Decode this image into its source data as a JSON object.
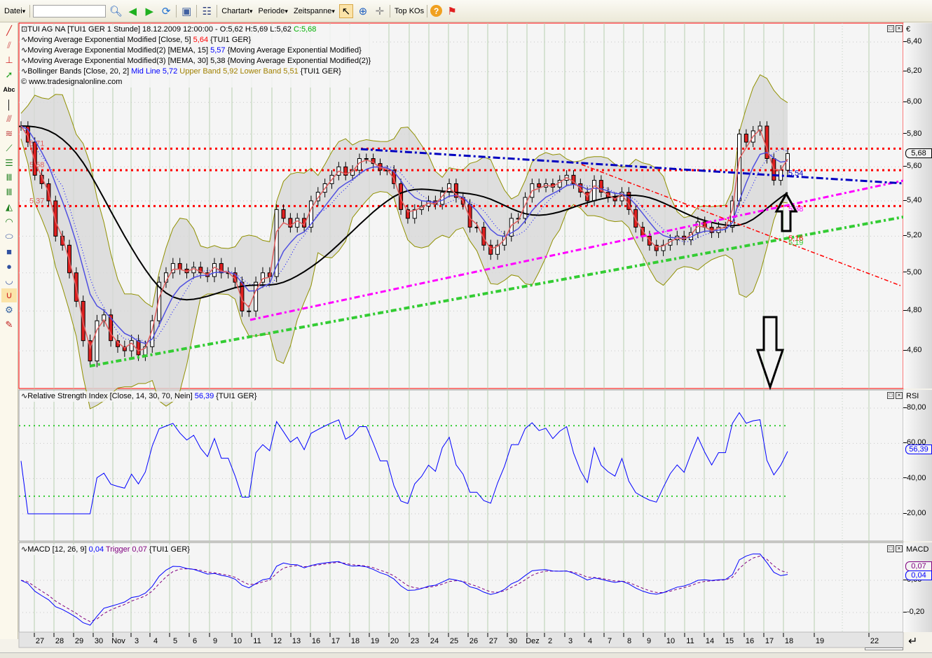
{
  "toolbar": {
    "file": "Datei",
    "search_value": "",
    "charttype": "Chartart",
    "period": "Periode",
    "timespan": "Zeitspanne",
    "topkos": "Top KOs"
  },
  "legend": {
    "title": "TUI AG NA [TUI1 GER  1 Stunde] 18.12.2009 12:00:00 - O:5,62 H:5,69 L:5,62 ",
    "close": "C:5,68",
    "ema5": "Moving Average Exponential Modified [Close, 5] ",
    "ema5_val": "5,64",
    "ema5_src": " {TUI1 GER}",
    "mema15": "Moving Average Exponential Modified(2) [MEMA, 15] ",
    "mema15_val": "5,57",
    "mema15_src": " {Moving Average Exponential Modified}",
    "mema30": "Moving Average Exponential Modified(3) [MEMA, 30] 5,38 {Moving Average Exponential Modified(2)}",
    "bb": "Bollinger Bands [Close, 20, 2] ",
    "bb_mid": "Mid Line 5,72",
    "bb_upper": " Upper Band 5,92",
    "bb_lower": " Lower Band 5,51",
    "bb_src": " {TUI1 GER}",
    "copyright": "© www.tradesignalonline.com"
  },
  "rsi_legend": {
    "text": "Relative Strength Index [Close, 14, 30, 70, Nein] ",
    "val": "56,39",
    "src": " {TUI1 GER}"
  },
  "macd_legend": {
    "text": "MACD [12, 26, 9] ",
    "val": "0,04",
    "trig": " Trigger 0,07",
    "src": " {TUI1 GER}"
  },
  "axes": {
    "currency": "€",
    "rsi": "RSI",
    "macd": "MACD",
    "price_ticks": [
      "6,40",
      "6,20",
      "6,00",
      "5,80",
      "5,60",
      "5,40",
      "5,20",
      "5,00",
      "4,80",
      "4,60"
    ],
    "rsi_ticks": [
      "80,00",
      "60,00",
      "40,00",
      "20,00"
    ],
    "macd_ticks": [
      "0,00",
      "-0,20"
    ],
    "price_marker": "5,68",
    "rsi_marker": "56,39",
    "macd_marker": "0,04",
    "macd_trig_marker": "0,07",
    "dates": [
      "27",
      "28",
      "29",
      "30",
      "Nov",
      "3",
      "4",
      "5",
      "6",
      "9",
      "10",
      "11",
      "12",
      "13",
      "16",
      "17",
      "18",
      "19",
      "20",
      "23",
      "24",
      "25",
      "26",
      "27",
      "30",
      "Dez",
      "2",
      "3",
      "4",
      "7",
      "8",
      "9",
      "10",
      "11",
      "14",
      "15",
      "16",
      "17",
      "18",
      "19",
      "22"
    ]
  },
  "levels": [
    {
      "label": "5,71",
      "value": 5.71
    },
    {
      "label": "5,58",
      "value": 5.58
    },
    {
      "label": "5,37",
      "value": 5.37
    }
  ],
  "trend_labels": {
    "blue": "5,54",
    "magenta": "5,38",
    "red": "5,16",
    "green": "5,19"
  },
  "colors": {
    "ema5": "#e06060",
    "mema15": "#5050e0",
    "mema30": "#000000",
    "rsi": "#0000ff",
    "macd": "#0000ff",
    "trigger": "#800080",
    "levels": "#ff0000",
    "green": "#33cc33",
    "magenta": "#ff00ff",
    "blue": "#0000c0"
  },
  "chart_data": {
    "type": "candlestick",
    "symbol": "TUI1 GER",
    "interval": "1 Stunde",
    "ylim": [
      4.5,
      6.5
    ],
    "close": [
      5.85,
      5.75,
      5.55,
      5.5,
      5.4,
      5.2,
      5.15,
      5.0,
      4.85,
      4.65,
      4.55,
      4.75,
      4.78,
      4.65,
      4.62,
      4.6,
      4.65,
      4.58,
      4.62,
      4.75,
      4.95,
      5.0,
      5.05,
      5.02,
      5.0,
      5.03,
      5.0,
      4.98,
      5.05,
      5.0,
      5.0,
      4.95,
      4.8,
      4.8,
      4.95,
      5.0,
      4.98,
      5.35,
      5.3,
      5.25,
      5.3,
      5.25,
      5.4,
      5.45,
      5.5,
      5.55,
      5.6,
      5.55,
      5.58,
      5.65,
      5.65,
      5.62,
      5.58,
      5.58,
      5.5,
      5.35,
      5.3,
      5.35,
      5.37,
      5.4,
      5.38,
      5.45,
      5.5,
      5.42,
      5.38,
      5.25,
      5.25,
      5.15,
      5.1,
      5.15,
      5.2,
      5.3,
      5.3,
      5.42,
      5.5,
      5.48,
      5.5,
      5.48,
      5.52,
      5.55,
      5.5,
      5.45,
      5.4,
      5.52,
      5.45,
      5.42,
      5.4,
      5.45,
      5.35,
      5.25,
      5.2,
      5.15,
      5.12,
      5.15,
      5.18,
      5.2,
      5.18,
      5.22,
      5.28,
      5.25,
      5.22,
      5.25,
      5.25,
      5.4,
      5.8,
      5.75,
      5.82,
      5.85,
      5.65,
      5.52,
      5.58,
      5.68
    ]
  }
}
